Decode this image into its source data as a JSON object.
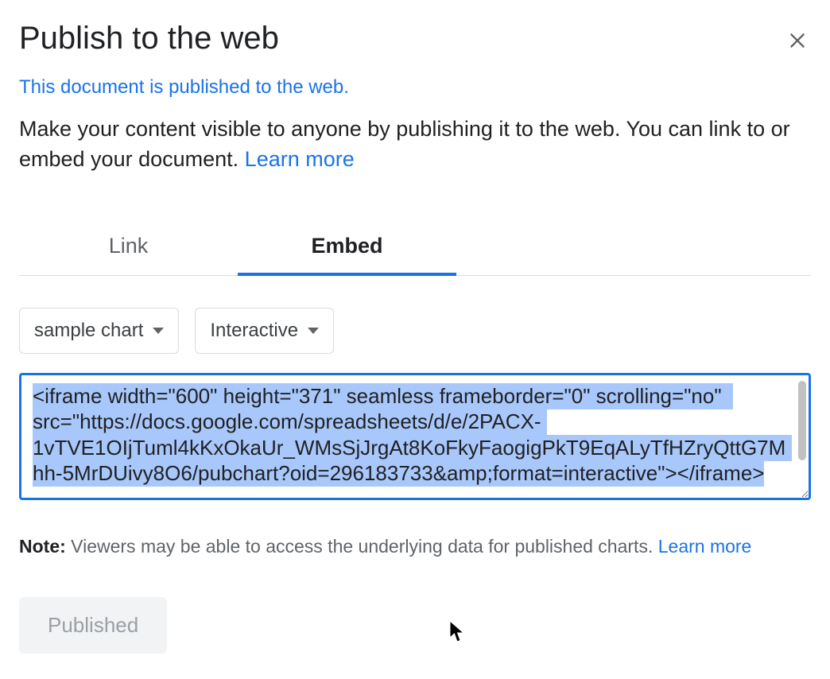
{
  "dialog": {
    "title": "Publish to the web",
    "status_link": "This document is published to the web.",
    "description_prefix": "Make your content visible to anyone by publishing it to the web. You can link to or embed your document. ",
    "learn_more": "Learn more"
  },
  "tabs": {
    "link": "Link",
    "embed": "Embed",
    "active": "embed"
  },
  "dropdowns": {
    "chart_select": "sample chart",
    "mode_select": "Interactive"
  },
  "embed": {
    "code": "<iframe width=\"600\" height=\"371\" seamless frameborder=\"0\" scrolling=\"no\" src=\"https://docs.google.com/spreadsheets/d/e/2PACX-1vTVE1OIjTuml4kKxOkaUr_WMsSjJrgAt8KoFkyFaogigPkT9EqALyTfHZryQttG7Mhh-5MrDUivy8O6/pubchart?oid=296183733&amp;format=interactive\"></iframe>"
  },
  "note": {
    "label": "Note:",
    "text": " Viewers may be able to access the underlying data for published charts. ",
    "learn_more": "Learn more"
  },
  "actions": {
    "published_button": "Published"
  }
}
